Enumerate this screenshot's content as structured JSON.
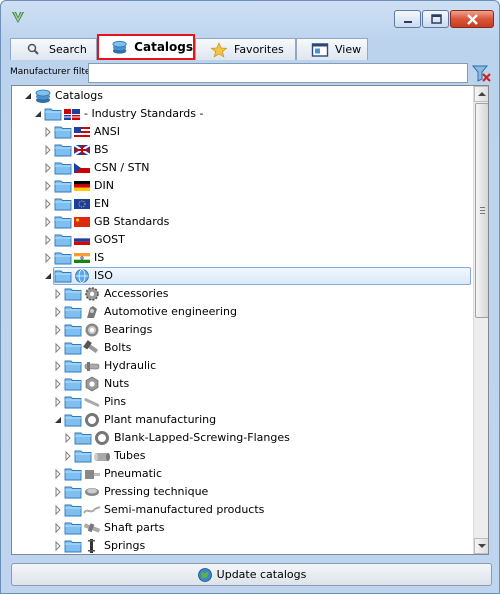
{
  "tabs": {
    "search": "Search",
    "catalogs": "Catalogs",
    "favorites": "Favorites",
    "view": "View"
  },
  "filter": {
    "label": "Manufacturer filter:",
    "value": ""
  },
  "tree": {
    "root": "Catalogs",
    "industry_standards": "- Industry Standards -",
    "standards": [
      "ANSI",
      "BS",
      "CSN / STN",
      "DIN",
      "EN",
      "GB Standards",
      "GOST",
      "IS"
    ],
    "iso": "ISO",
    "iso_children": [
      "Accessories",
      "Automotive engineering",
      "Bearings",
      "Bolts",
      "Hydraulic",
      "Nuts",
      "Pins"
    ],
    "plant_manufacturing": "Plant manufacturing",
    "plant_children": [
      "Blank-Lapped-Screwing-Flanges",
      "Tubes"
    ],
    "iso_rest": [
      "Pneumatic",
      "Pressing technique",
      "Semi-manufactured products",
      "Shaft parts",
      "Springs"
    ]
  },
  "update_button": "Update catalogs",
  "colors": {
    "tab_highlight": "#e5141b",
    "selection_border": "#84acdd",
    "folder": "#7fc0f0"
  }
}
